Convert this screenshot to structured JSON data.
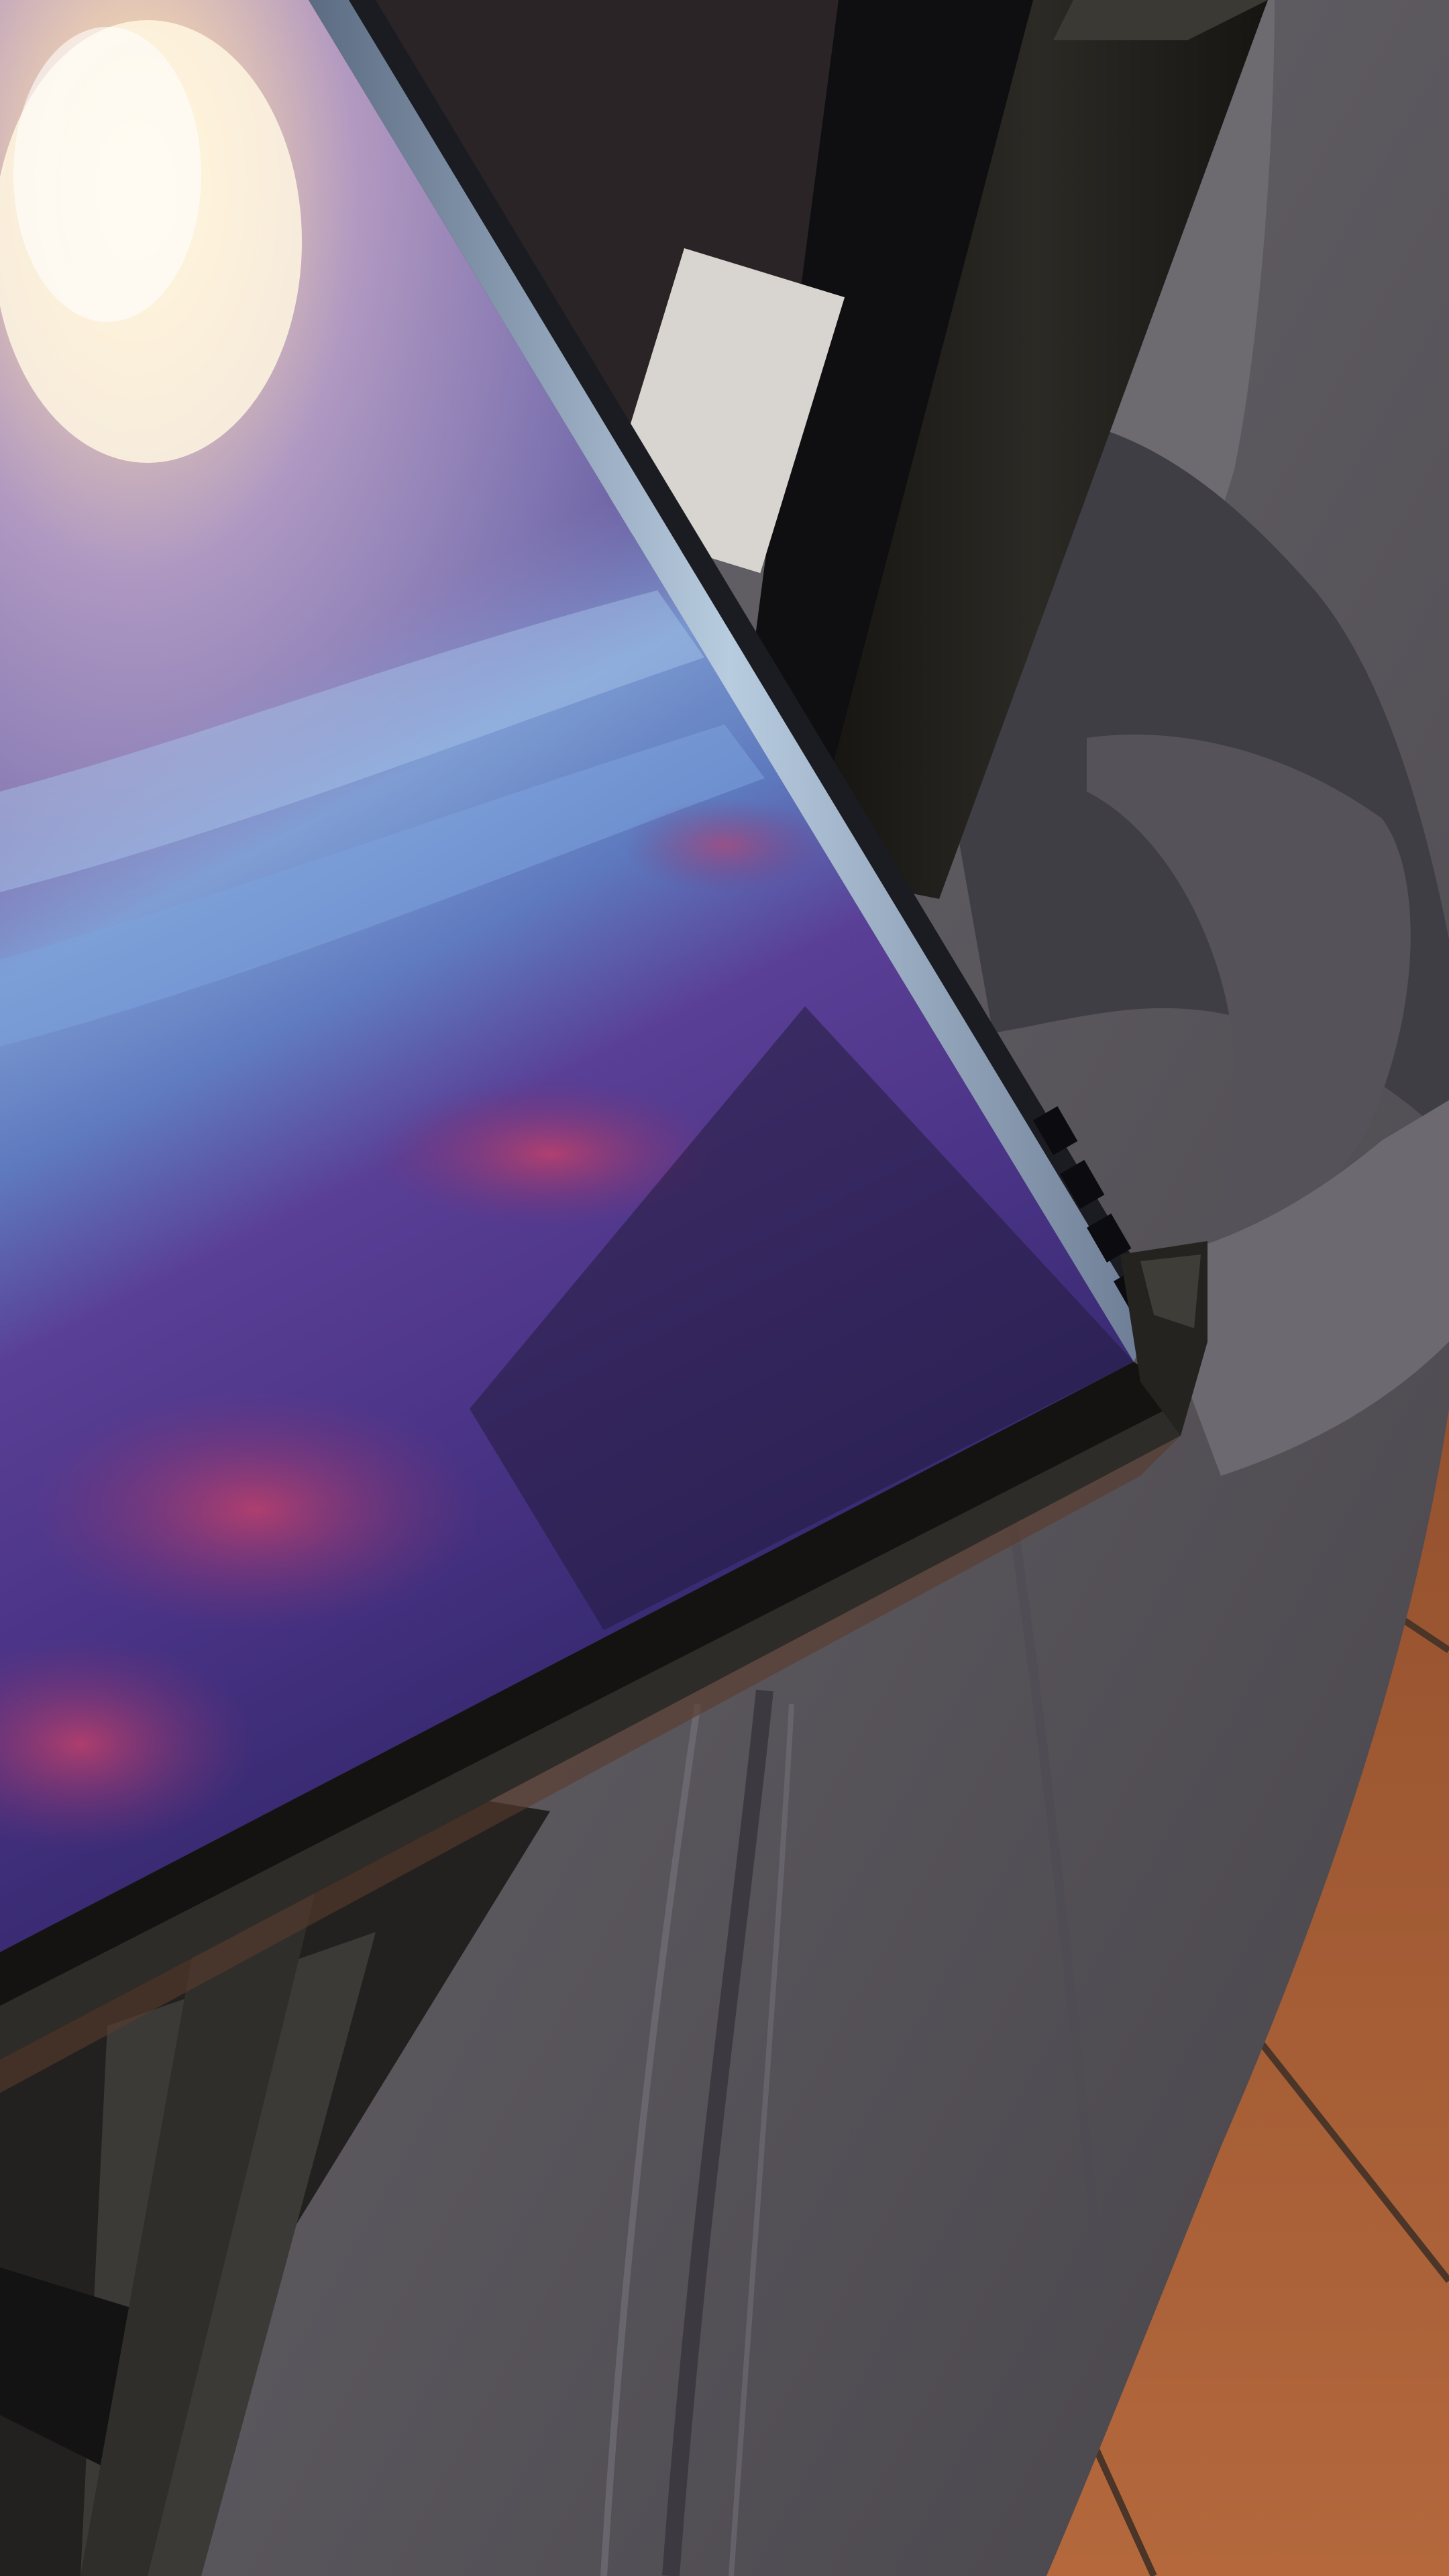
{
  "scene": {
    "subject": "photo-of-display-panel",
    "colors": {
      "background": "#2a2426",
      "floor_tile": "#a0582f",
      "floor_grout": "#4a3528",
      "fabric": "#5d5a5f",
      "fabric_dark": "#3f3d43",
      "fabric_light": "#7d7a80",
      "frame": "#1b1a18",
      "frame_tape": "#2a2a26",
      "panel_edge": "#9fb3c9",
      "sky_glow": "#fff1d0",
      "sky": "#8a7cb0",
      "water": "#6b8fc4",
      "heath_purple": "#5c3f96",
      "heath_red": "#b0385c",
      "shadow": "#120f14",
      "sticker": "#d8d4cf"
    },
    "sticker_lines": [
      "",
      "",
      ""
    ]
  }
}
